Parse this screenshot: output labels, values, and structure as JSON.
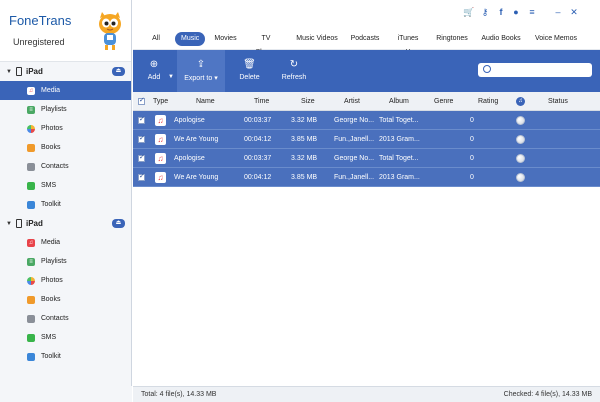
{
  "app": {
    "name": "FoneTrans",
    "status": "Unregistered"
  },
  "title_controls": [
    "cart-icon",
    "key-icon",
    "facebook-icon",
    "feedback-icon",
    "menu-icon",
    "minimize-icon",
    "close-icon"
  ],
  "devices": [
    {
      "name": "iPad",
      "items": [
        "Media",
        "Playlists",
        "Photos",
        "Books",
        "Contacts",
        "SMS",
        "Toolkit"
      ],
      "active": 0
    },
    {
      "name": "iPad",
      "items": [
        "Media",
        "Playlists",
        "Photos",
        "Books",
        "Contacts",
        "SMS",
        "Toolkit"
      ],
      "active": -1
    }
  ],
  "tabs": [
    "All",
    "Music",
    "Movies",
    "TV Shows",
    "Music Videos",
    "Podcasts",
    "iTunes U",
    "Ringtones",
    "Audio Books",
    "Voice Memos"
  ],
  "active_tab": "Music",
  "toolbar": {
    "add": "Add",
    "export": "Export to",
    "delete": "Delete",
    "refresh": "Refresh"
  },
  "search": {
    "placeholder": ""
  },
  "table": {
    "headers": {
      "type": "Type",
      "name": "Name",
      "time": "Time",
      "size": "Size",
      "artist": "Artist",
      "album": "Album",
      "genre": "Genre",
      "rating": "Rating",
      "status": "Status"
    },
    "rows": [
      {
        "name": "Apologise",
        "time": "00:03:37",
        "size": "3.32 MB",
        "artist": "George No...",
        "album": "Total Toget...",
        "rating": "0"
      },
      {
        "name": "We Are Young",
        "time": "00:04:12",
        "size": "3.85 MB",
        "artist": "Fun.,Janell...",
        "album": "2013 Gram...",
        "rating": "0"
      },
      {
        "name": "Apologise",
        "time": "00:03:37",
        "size": "3.32 MB",
        "artist": "George No...",
        "album": "Total Toget...",
        "rating": "0"
      },
      {
        "name": "We Are Young",
        "time": "00:04:12",
        "size": "3.85 MB",
        "artist": "Fun.,Janell...",
        "album": "2013 Gram...",
        "rating": "0"
      }
    ]
  },
  "status": {
    "total": "Total: 4 file(s), 14.33 MB",
    "checked": "Checked: 4 file(s), 14.33 MB"
  },
  "colors": {
    "accent": "#3a64b8",
    "selected_row": "#4a70bd",
    "brand": "#1d5aa8"
  }
}
